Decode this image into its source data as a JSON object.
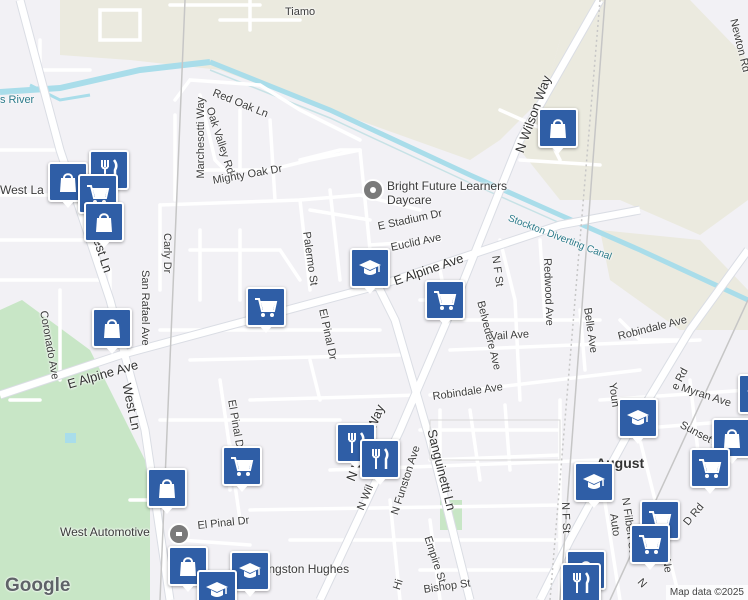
{
  "map": {
    "attribution": "Map data ©2025",
    "logo": "Google",
    "colors": {
      "background": "#f2f1f5",
      "field": "#ebeadf",
      "park": "#c8e6c6",
      "water": "#a9ddea",
      "road": "#ffffff",
      "marker": "#2f5ea6"
    },
    "road_labels": [
      "Tiamo",
      "Red Oak Ln",
      "Oak Valley Rd",
      "Marchesotti Way",
      "Mighty Oak Dr",
      "Carly Dr",
      "E Stadium Dr",
      "Euclid Ave",
      "E Alpine Ave",
      "Palermo St",
      "El Pinal Dr",
      "San Rafael Ave",
      "Coronado Ave",
      "E Alpine Ave",
      "West Ln",
      "West Ln",
      "N Wilson Way",
      "N F St",
      "Redwood Ave",
      "Belvedere Ave",
      "Vail Ave",
      "Robindale Ave",
      "Robindale Ave",
      "Belle Ave",
      "Sanguinetti Ln",
      "N Wilson Way",
      "N Funston Ave",
      "Empire St",
      "El Pinal Dr",
      "El Pinal Dr",
      "Bishop St",
      "Hi",
      "N F St",
      "N Filbert St",
      "Myran Ave",
      "Sunset Av",
      "Newton Rd",
      "Youn",
      "Auto",
      "D Rd",
      "N Wil",
      "N",
      "Ne",
      "e Rd",
      "s River"
    ],
    "place_labels": {
      "daycare": "Bright Future Learners Daycare",
      "canal": "Stockton Diverting Canal",
      "west_lane": "West La",
      "august": "August",
      "west_automotive": "West Automotive",
      "langston": "Langston Hughes"
    },
    "markers": [
      {
        "type": "shopping-bag"
      },
      {
        "type": "restaurant"
      },
      {
        "type": "shopping-cart"
      },
      {
        "type": "shopping-bag"
      },
      {
        "type": "shopping-bag"
      },
      {
        "type": "school"
      },
      {
        "type": "shopping-cart"
      },
      {
        "type": "shopping-cart"
      },
      {
        "type": "shopping-bag"
      },
      {
        "type": "restaurant"
      },
      {
        "type": "restaurant"
      },
      {
        "type": "shopping-cart"
      },
      {
        "type": "shopping-bag"
      },
      {
        "type": "school"
      },
      {
        "type": "shopping-bag"
      },
      {
        "type": "school"
      },
      {
        "type": "school"
      },
      {
        "type": "shopping-bag"
      },
      {
        "type": "school"
      },
      {
        "type": "shopping-cart"
      },
      {
        "type": "shopping-cart"
      },
      {
        "type": "shopping-cart"
      },
      {
        "type": "shopping-bag"
      },
      {
        "type": "restaurant"
      },
      {
        "type": "school"
      }
    ]
  }
}
